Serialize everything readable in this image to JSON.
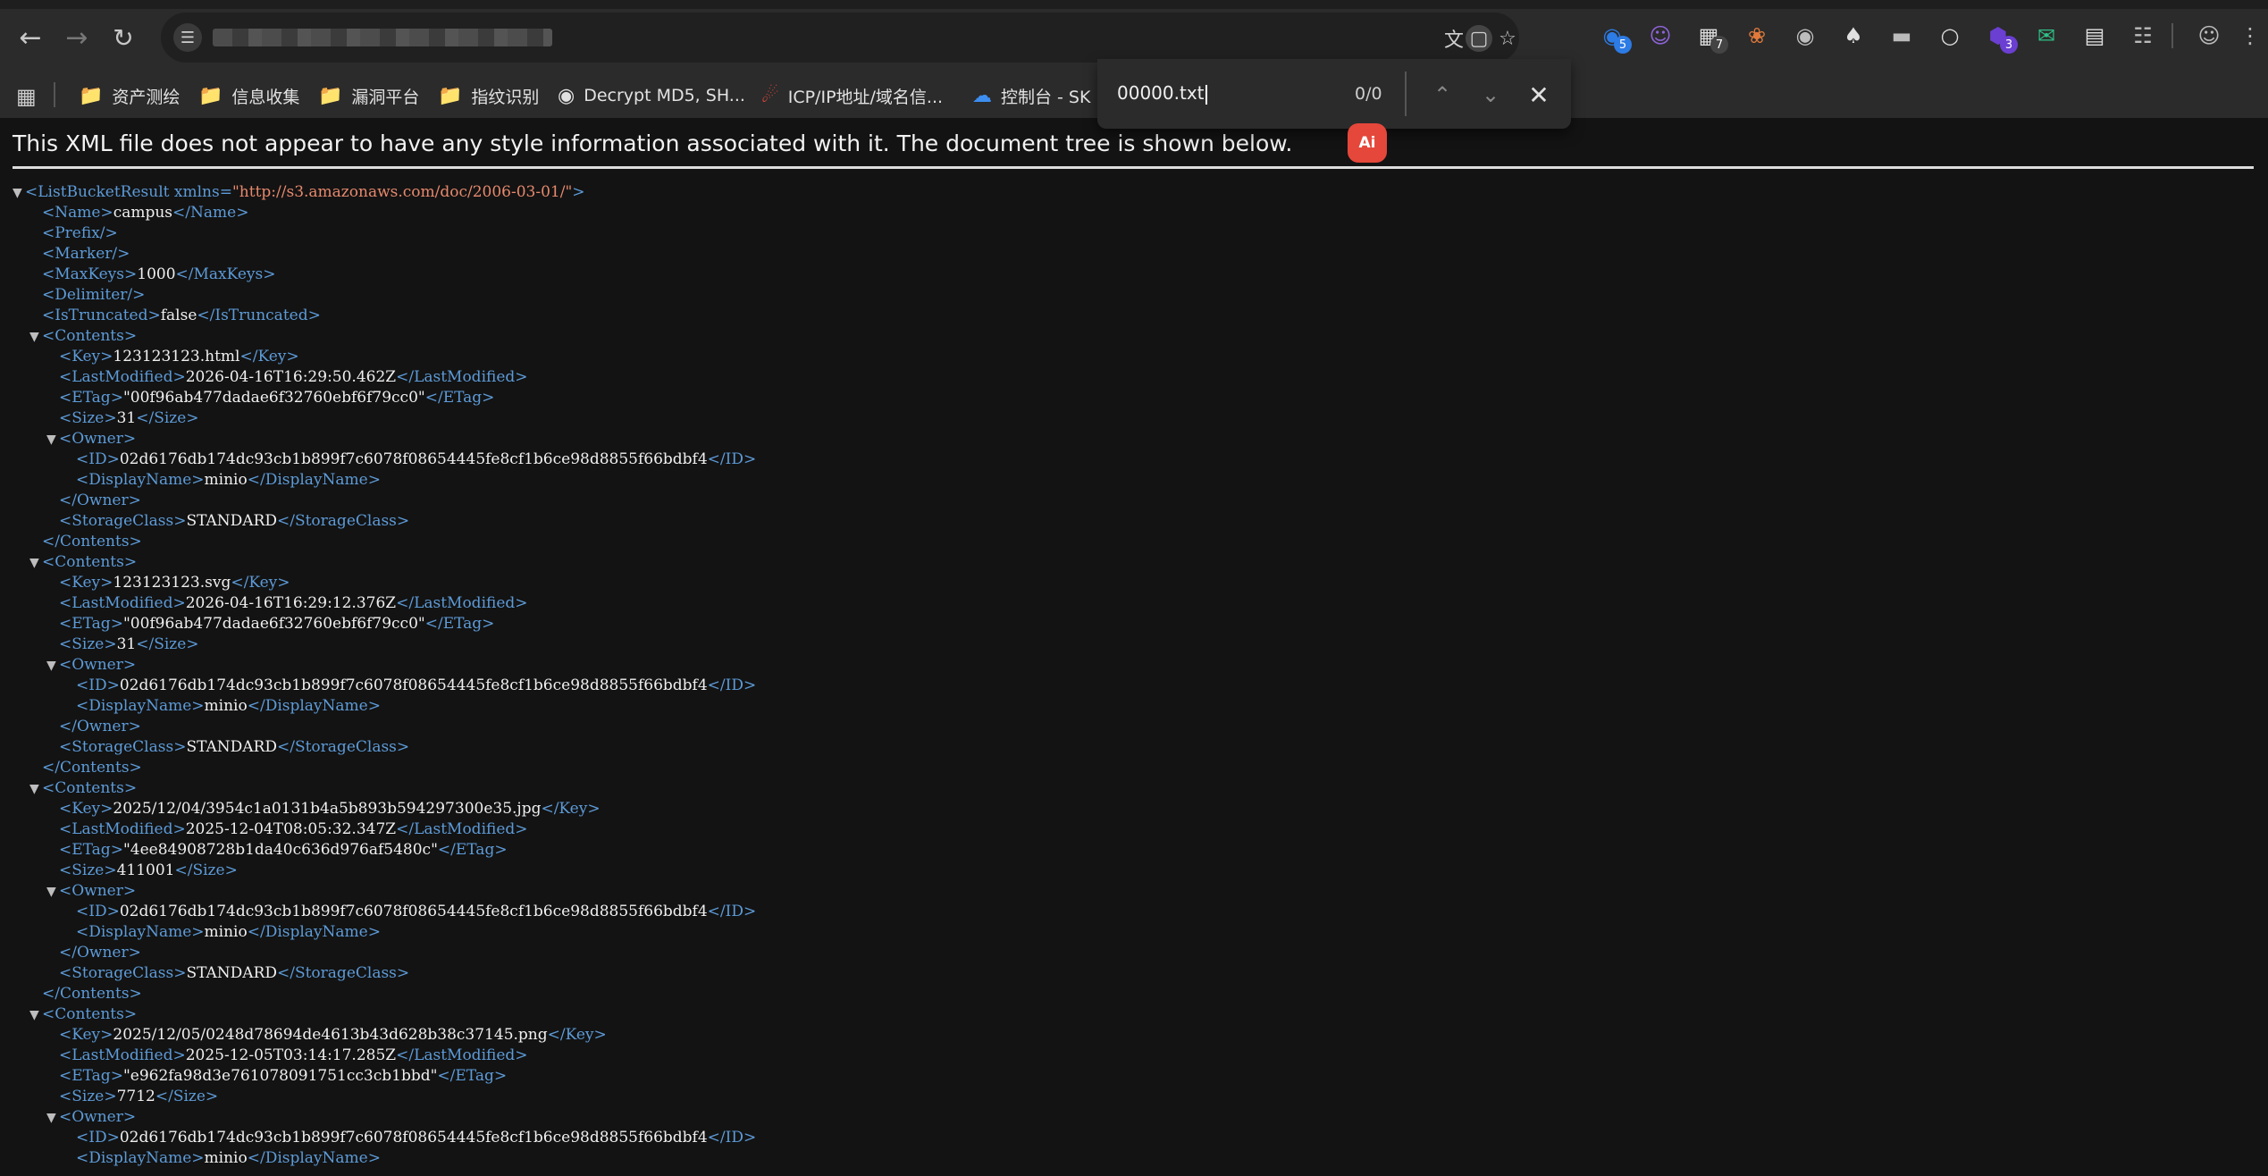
{
  "find_bar": {
    "query": "00000.txt",
    "count": "0/0"
  },
  "ai_badge": "Ai",
  "bookmarks": [
    {
      "label": "资产测绘",
      "icon": "folder-icon"
    },
    {
      "label": "信息收集",
      "icon": "folder-icon"
    },
    {
      "label": "漏洞平台",
      "icon": "folder-icon"
    },
    {
      "label": "指纹识别",
      "icon": "folder-icon"
    },
    {
      "label": "Decrypt MD5, SH...",
      "icon": "globe-icon"
    },
    {
      "label": "ICP/IP地址/域名信...",
      "icon": "site-icon"
    },
    {
      "label": "控制台 - SK",
      "icon": "cloud-icon"
    }
  ],
  "extensions": [
    {
      "name": "ext-shield",
      "badge": "5",
      "badge_color": "#2d7be5"
    },
    {
      "name": "ext-cat",
      "badge": "",
      "badge_color": ""
    },
    {
      "name": "ext-grid",
      "badge": "7",
      "badge_color": "#444444"
    },
    {
      "name": "ext-cookie",
      "badge": "",
      "badge_color": ""
    },
    {
      "name": "ext-record",
      "badge": "",
      "badge_color": ""
    },
    {
      "name": "ext-spade",
      "badge": "",
      "badge_color": ""
    },
    {
      "name": "ext-hat",
      "badge": "",
      "badge_color": ""
    },
    {
      "name": "ext-wechat",
      "badge": "",
      "badge_color": ""
    },
    {
      "name": "ext-purple",
      "badge": "3",
      "badge_color": "#6a3fd1"
    },
    {
      "name": "ext-mail",
      "badge": "",
      "badge_color": ""
    },
    {
      "name": "ext-doc",
      "badge": "",
      "badge_color": ""
    }
  ],
  "xml_notice": "This XML file does not appear to have any style information associated with it. The document tree is shown below.",
  "xml": {
    "root_tag": "ListBucketResult",
    "root_attr_name": "xmlns",
    "root_attr_value": "\"http://s3.amazonaws.com/doc/2006-03-01/\"",
    "name": "campus",
    "max_keys": "1000",
    "is_truncated": "false",
    "contents": [
      {
        "key": "123123123.html",
        "last_modified": "2026-04-16T16:29:50.462Z",
        "etag": "\"00f96ab477dadae6f32760ebf6f79cc0\"",
        "size": "31",
        "owner_id": "02d6176db174dc93cb1b899f7c6078f08654445fe8cf1b6ce98d8855f66bdbf4",
        "display_name": "minio",
        "storage_class": "STANDARD"
      },
      {
        "key": "123123123.svg",
        "last_modified": "2026-04-16T16:29:12.376Z",
        "etag": "\"00f96ab477dadae6f32760ebf6f79cc0\"",
        "size": "31",
        "owner_id": "02d6176db174dc93cb1b899f7c6078f08654445fe8cf1b6ce98d8855f66bdbf4",
        "display_name": "minio",
        "storage_class": "STANDARD"
      },
      {
        "key": "2025/12/04/3954c1a0131b4a5b893b594297300e35.jpg",
        "last_modified": "2025-12-04T08:05:32.347Z",
        "etag": "\"4ee84908728b1da40c636d976af5480c\"",
        "size": "411001",
        "owner_id": "02d6176db174dc93cb1b899f7c6078f08654445fe8cf1b6ce98d8855f66bdbf4",
        "display_name": "minio",
        "storage_class": "STANDARD"
      },
      {
        "key": "2025/12/05/0248d78694de4613b43d628b38c37145.png",
        "last_modified": "2025-12-05T03:14:17.285Z",
        "etag": "\"e962fa98d3e761078091751cc3cb1bbd\"",
        "size": "7712",
        "owner_id": "02d6176db174dc93cb1b899f7c6078f08654445fe8cf1b6ce98d8855f66bdbf4",
        "display_name": "minio",
        "storage_class": ""
      }
    ]
  }
}
